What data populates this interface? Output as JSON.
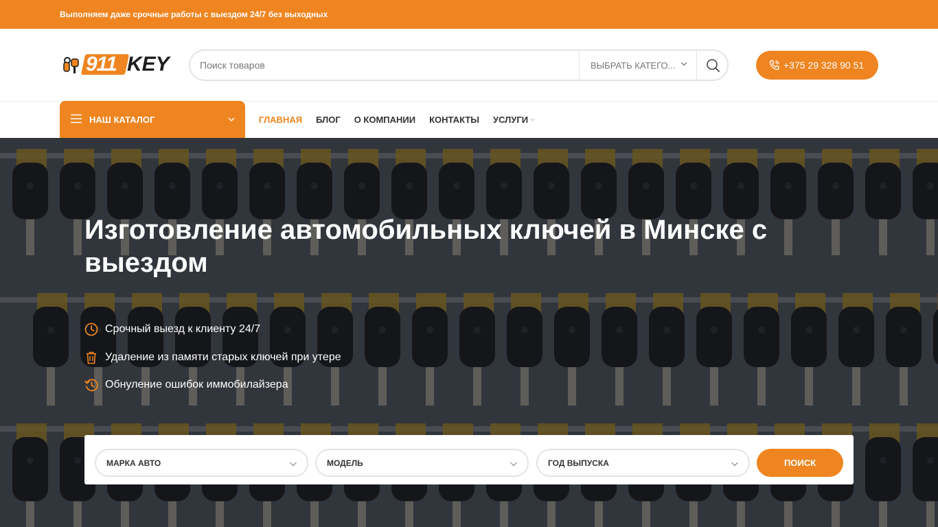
{
  "topbar": {
    "text": "Выполняем даже срочные работы с выездом 24/7 без выходных"
  },
  "logo": {
    "number": "911",
    "word": "KEY"
  },
  "search": {
    "placeholder": "Поиск товаров",
    "category_label": "Выбрать катего...",
    "icon": "search-icon"
  },
  "phone": {
    "label": "+375 29 328 90 51",
    "icon": "phone-icon"
  },
  "nav": {
    "catalog_label": "НАШ КАТАЛОГ",
    "links": [
      {
        "label": "ГЛАВНАЯ",
        "active": true
      },
      {
        "label": "БЛОГ"
      },
      {
        "label": "О КОМПАНИИ"
      },
      {
        "label": "КОНТАКТЫ"
      },
      {
        "label": "УСЛУГИ"
      }
    ]
  },
  "hero": {
    "title": "Изготовление автомобильных ключей в Минске с выездом",
    "features": [
      {
        "text": "Срочный выезд к клиенту 24/7",
        "icon": "clock-icon"
      },
      {
        "text": "Удаление из памяти старых ключей при утере",
        "icon": "trash-icon"
      },
      {
        "text": "Обнуление ошибок иммобилайзера",
        "icon": "history-icon"
      }
    ]
  },
  "finder": {
    "brand_label": "МАРКА АВТО",
    "model_label": "МОДЕЛЬ",
    "year_label": "ГОД ВЫПУСКА",
    "button_label": "ПОИСК"
  },
  "colors": {
    "accent": "#ef8520",
    "dark": "#1d1d1d"
  }
}
